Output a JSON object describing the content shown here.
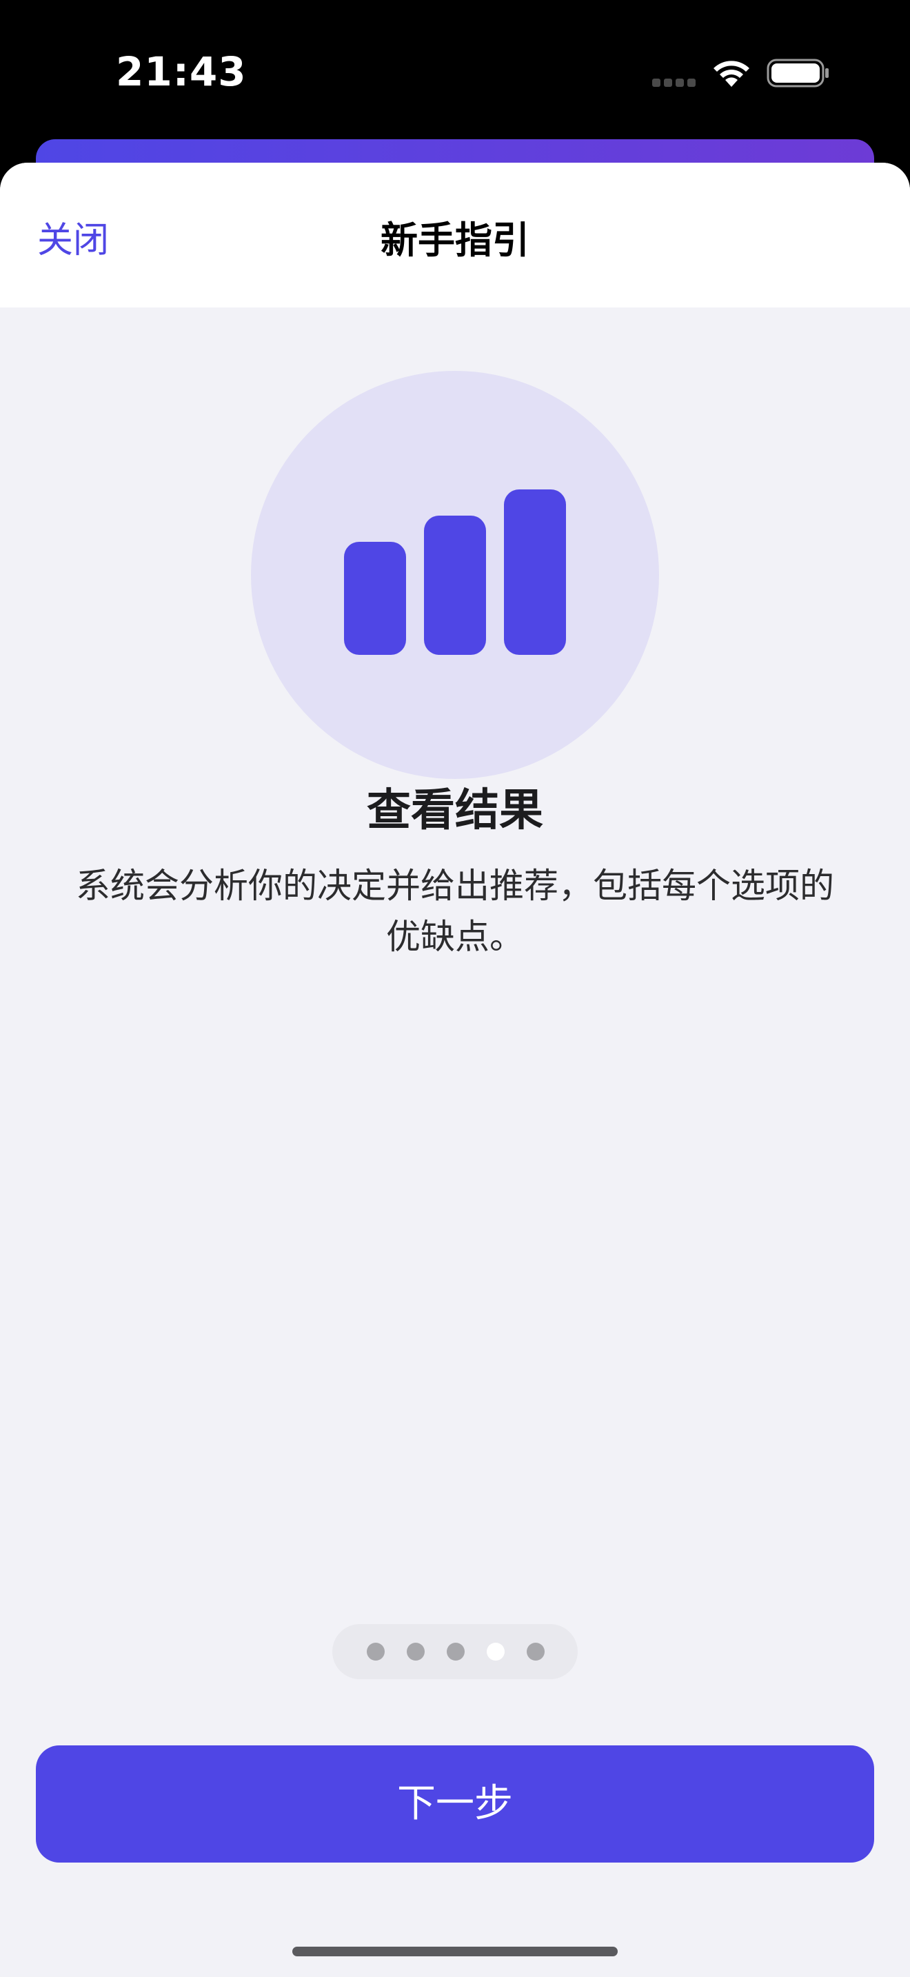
{
  "status_bar": {
    "time": "21:43",
    "signal_icon": "cellular-signal-icon",
    "wifi_icon": "wifi-icon",
    "battery_icon": "battery-icon"
  },
  "nav": {
    "close_label": "关闭",
    "title": "新手指引"
  },
  "onboarding": {
    "illustration_icon": "bar-chart-icon",
    "title": "查看结果",
    "description": "系统会分析你的决定并给出推荐，包括每个选项的优缺点。"
  },
  "pagination": {
    "total_pages": 5,
    "current_page": 4
  },
  "actions": {
    "next_label": "下一步"
  },
  "colors": {
    "accent": "#4f46e5",
    "illustration_bg": "#e2e0f6",
    "sheet_bg": "#f2f2f7",
    "nav_bg": "#ffffff"
  }
}
